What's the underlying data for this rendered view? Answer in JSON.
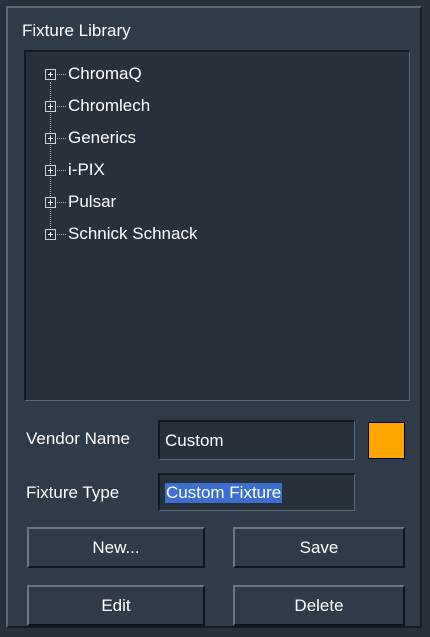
{
  "library": {
    "title": "Fixture Library",
    "vendors": [
      {
        "label": "ChromaQ",
        "expanded": false
      },
      {
        "label": "Chromlech",
        "expanded": false
      },
      {
        "label": "Generics",
        "expanded": false
      },
      {
        "label": "i-PIX",
        "expanded": false
      },
      {
        "label": "Pulsar",
        "expanded": false
      },
      {
        "label": "Schnick Schnack",
        "expanded": false
      }
    ]
  },
  "form": {
    "vendor_name_label": "Vendor Name",
    "vendor_name_value": "Custom",
    "fixture_type_label": "Fixture Type",
    "fixture_type_value": "Custom Fixture",
    "swatch_color": "#ffa500"
  },
  "buttons": {
    "new": "New...",
    "save": "Save",
    "edit": "Edit",
    "delete": "Delete"
  },
  "colors": {
    "background": "#27313c",
    "panel": "#2f3b49",
    "selection": "#3d6fce"
  }
}
